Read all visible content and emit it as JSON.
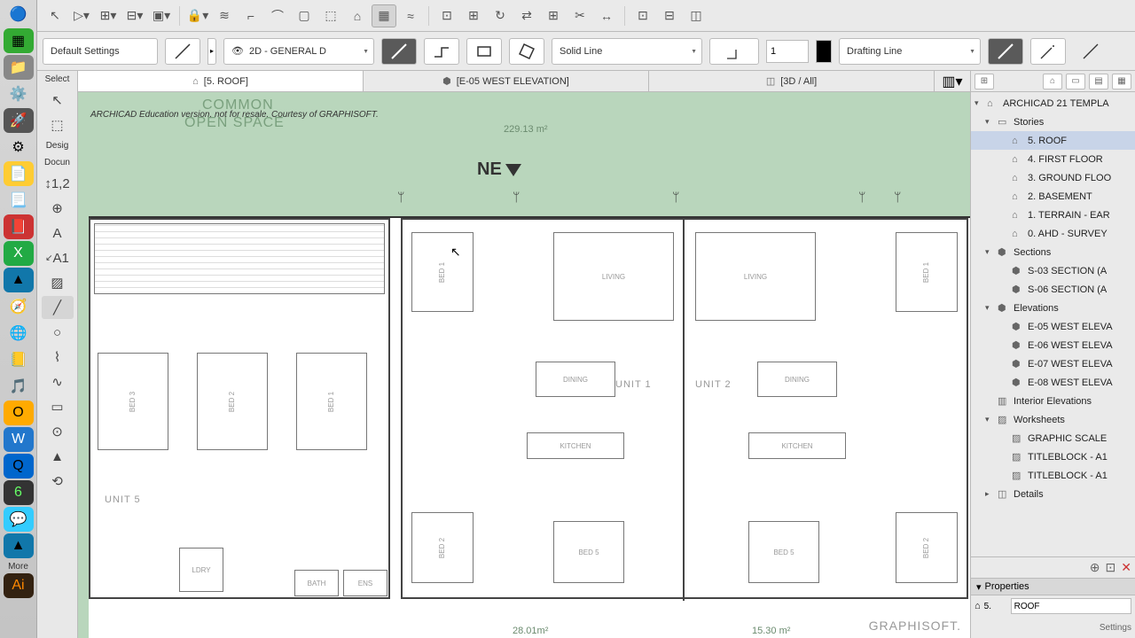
{
  "dock": {
    "items": [
      "🔵",
      "🟩",
      "📁",
      "⚙️",
      "🚀",
      "⚙",
      "📝",
      "📄",
      "📕",
      "✖️",
      "🔷",
      "🧭",
      "🌐",
      "🎵",
      "🟡",
      "🔵",
      "📘",
      "🔍",
      "🟢",
      "💬",
      "🔺",
      "⬛"
    ],
    "more_label": "More"
  },
  "settings": {
    "default_label": "Default Settings",
    "view_label": "2D - GENERAL D",
    "line_label": "Solid Line",
    "num_value": "1",
    "layer_label": "Drafting Line"
  },
  "left_tools": {
    "select_label": "Select",
    "design_label": "Desig",
    "docs_label": "Docun",
    "a1_label": "A1"
  },
  "tabs": [
    {
      "icon": "⌂",
      "label": "[5. ROOF]"
    },
    {
      "icon": "⬢",
      "label": "[E-05 WEST ELEVATION]"
    },
    {
      "icon": "◫",
      "label": "[3D / All]"
    }
  ],
  "canvas": {
    "watermark": "ARCHICAD Education version, not for resale. Courtesy of GRAPHISOFT.",
    "common1": "COMMON",
    "common2": "OPEN SPACE",
    "ne_label": "NE",
    "dim_top": "229.13 m²",
    "dim_b1": "28.01m²",
    "dim_b2": "15.30 m²",
    "logo": "GRAPHISOFT.",
    "unit1": "UNIT 1",
    "unit2": "UNIT 2",
    "unit5": "UNIT 5",
    "living": "LIVING",
    "dining": "DINING",
    "kitchen": "KITCHEN",
    "bed1": "BED 1",
    "bed2": "BED 2",
    "bed3": "BED 3",
    "bed5": "BED 5",
    "bath": "BATH",
    "ldry": "LDRY",
    "ens": "ENS"
  },
  "navigator": {
    "root": "ARCHICAD 21 TEMPLA",
    "stories": "Stories",
    "story_items": [
      "5. ROOF",
      "4. FIRST FLOOR",
      "3. GROUND FLOO",
      "2. BASEMENT",
      "1. TERRAIN - EAR",
      "0. AHD - SURVEY"
    ],
    "sections": "Sections",
    "section_items": [
      "S-03 SECTION (A",
      "S-06 SECTION (A"
    ],
    "elevations": "Elevations",
    "elevation_items": [
      "E-05 WEST ELEVA",
      "E-06 WEST ELEVA",
      "E-07 WEST ELEVA",
      "E-08 WEST ELEVA"
    ],
    "interior": "Interior Elevations",
    "worksheets": "Worksheets",
    "worksheet_items": [
      "GRAPHIC SCALE",
      "TITLEBLOCK - A1",
      "TITLEBLOCK - A1"
    ],
    "details": "Details"
  },
  "properties": {
    "header": "Properties",
    "num": "5.",
    "name": "ROOF",
    "settings": "Settings"
  }
}
